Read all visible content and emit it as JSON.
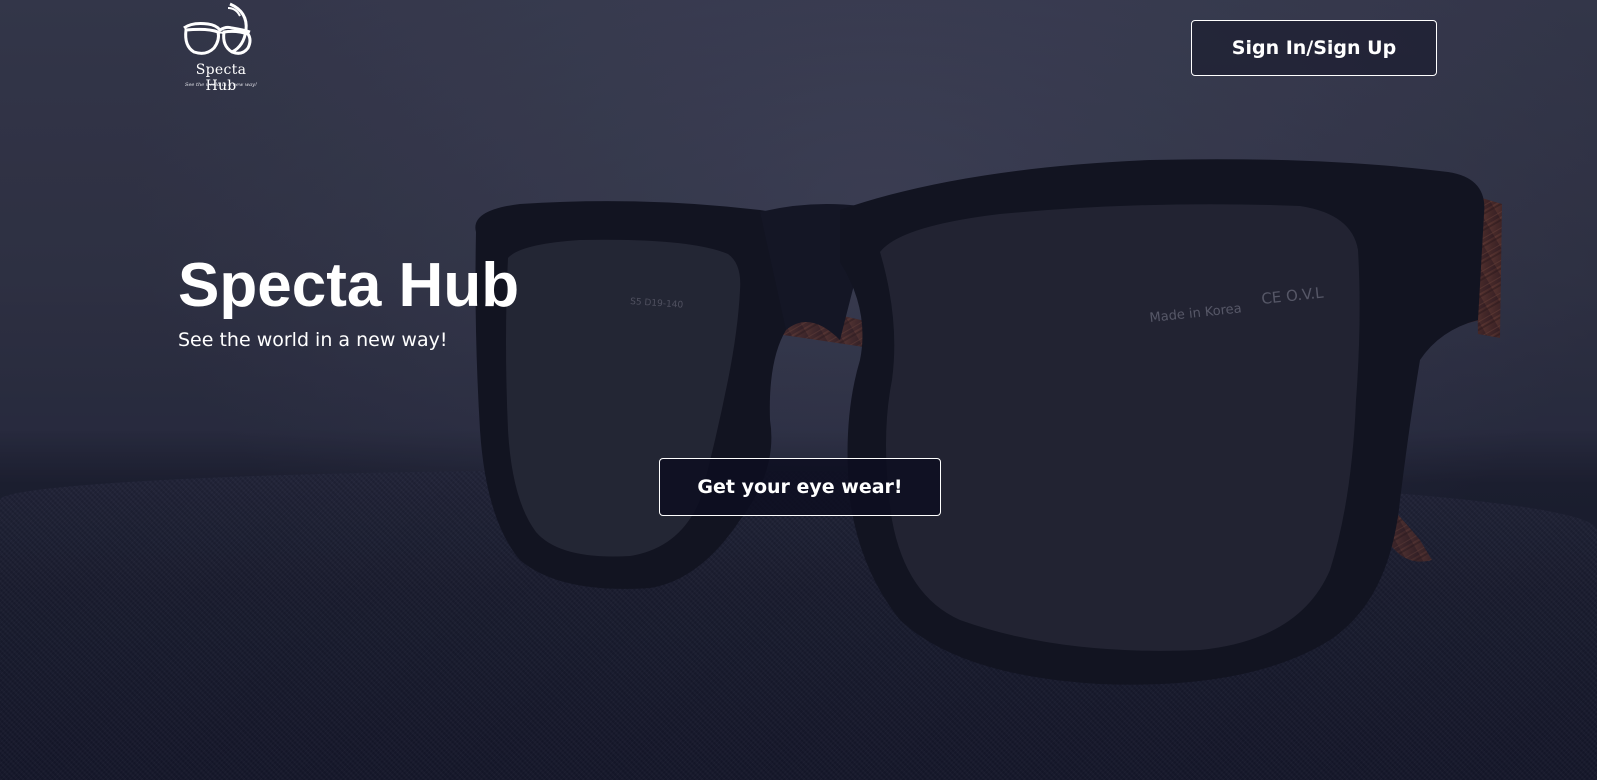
{
  "brand": {
    "logo_name": "Specta Hub",
    "logo_tagline": "See the world in a new way!"
  },
  "header": {
    "signin_label": "Sign In/Sign Up"
  },
  "hero": {
    "title": "Specta Hub",
    "subtitle": "See the world in a new way!",
    "cta_label": "Get your eye wear!"
  },
  "colors": {
    "overlay": "#202233",
    "text": "#ffffff",
    "button_border": "#ffffff"
  }
}
